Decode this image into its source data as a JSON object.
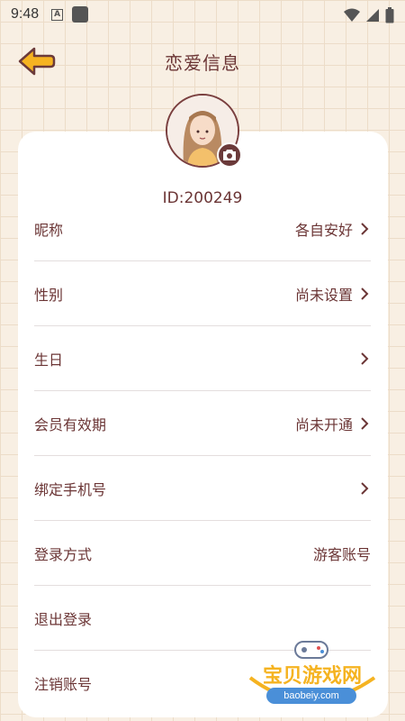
{
  "status_bar": {
    "time": "9:48",
    "notification_icon": "a-letter-icon"
  },
  "header": {
    "title": "恋爱信息",
    "back_icon": "arrow-left-icon"
  },
  "profile": {
    "id_label": "ID:200249",
    "avatar_icon": "girl-avatar",
    "camera_icon": "camera-icon"
  },
  "rows": [
    {
      "label": "昵称",
      "value": "各自安好",
      "has_arrow": true
    },
    {
      "label": "性别",
      "value": "尚未设置",
      "has_arrow": true
    },
    {
      "label": "生日",
      "value": "",
      "has_arrow": true
    },
    {
      "label": "会员有效期",
      "value": "尚未开通",
      "has_arrow": true
    },
    {
      "label": "绑定手机号",
      "value": "",
      "has_arrow": true
    },
    {
      "label": "登录方式",
      "value": "游客账号",
      "has_arrow": false
    },
    {
      "label": "退出登录",
      "value": "",
      "has_arrow": false
    },
    {
      "label": "注销账号",
      "value": "",
      "has_arrow": false
    }
  ],
  "watermark": {
    "text": "宝贝游戏网",
    "url": "baobeiy.com"
  },
  "colors": {
    "accent": "#6b3535",
    "background": "#f8efe3",
    "back_arrow": "#f5b321"
  }
}
